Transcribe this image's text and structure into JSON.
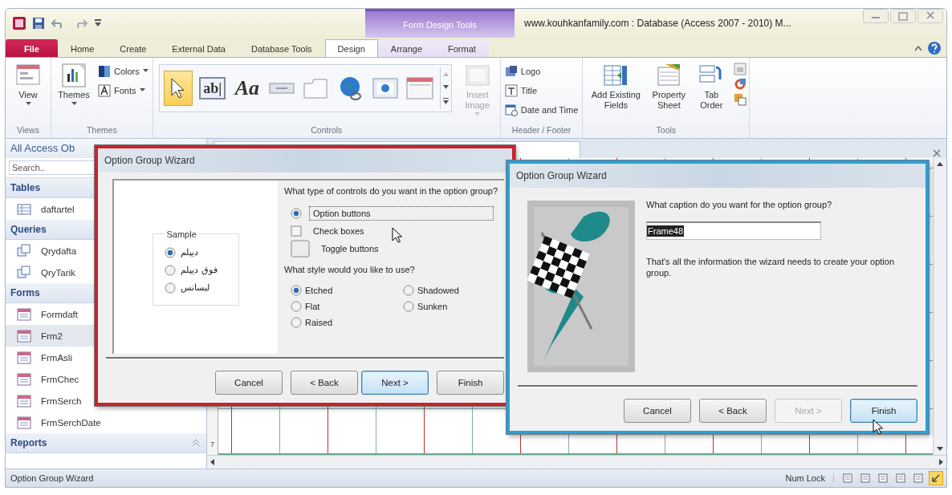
{
  "window": {
    "contextual_tab": "Form Design Tools",
    "title": "www.kouhkanfamily.com : Database (Access 2007 - 2010) M..."
  },
  "ribbon_tabs": [
    {
      "label": "File",
      "kind": "file",
      "selected": false
    },
    {
      "label": "Home",
      "kind": "tab",
      "selected": false
    },
    {
      "label": "Create",
      "kind": "tab",
      "selected": false
    },
    {
      "label": "External Data",
      "kind": "tab",
      "selected": false
    },
    {
      "label": "Database Tools",
      "kind": "tab",
      "selected": false
    },
    {
      "label": "Design",
      "kind": "contextual",
      "selected": true
    },
    {
      "label": "Arrange",
      "kind": "contextual",
      "selected": false
    },
    {
      "label": "Format",
      "kind": "contextual",
      "selected": false
    }
  ],
  "ribbon_groups": [
    {
      "label": "Views",
      "kind": "buttons",
      "items": [
        {
          "label": "View",
          "kind": "large",
          "dropdown": true,
          "disabled": false
        }
      ]
    },
    {
      "label": "Themes",
      "kind": "buttons",
      "items": [
        {
          "label": "Themes",
          "kind": "large",
          "dropdown": true,
          "disabled": false
        },
        {
          "label": "Colors",
          "kind": "small",
          "dropdown": true,
          "disabled": false
        },
        {
          "label": "Fonts",
          "kind": "small",
          "dropdown": true,
          "disabled": false
        }
      ]
    },
    {
      "label": "Controls",
      "kind": "gallery",
      "gallery": [
        {
          "kind": "pointer",
          "selected": true
        },
        {
          "kind": "text_box",
          "glyph": "ab|",
          "selected": false
        },
        {
          "kind": "label",
          "glyph": "Aa",
          "selected": false
        },
        {
          "kind": "button",
          "selected": false
        },
        {
          "kind": "tab_control",
          "selected": false
        },
        {
          "kind": "hyperlink",
          "selected": false
        },
        {
          "kind": "web_browser",
          "selected": false
        },
        {
          "kind": "navigation",
          "selected": false
        }
      ],
      "items": [
        {
          "label": "Insert Image",
          "kind": "large",
          "dropdown": true,
          "disabled": true
        }
      ]
    },
    {
      "label": "Header / Footer",
      "kind": "buttons",
      "items": [
        {
          "label": "Logo",
          "kind": "small",
          "dropdown": false,
          "disabled": false
        },
        {
          "label": "Title",
          "kind": "small",
          "dropdown": false,
          "disabled": false
        },
        {
          "label": "Date and Time",
          "kind": "small",
          "dropdown": false,
          "disabled": false
        }
      ]
    },
    {
      "label": "Tools",
      "kind": "buttons",
      "items": [
        {
          "label": "Add Existing Fields",
          "kind": "large",
          "dropdown": false,
          "disabled": false
        },
        {
          "label": "Property Sheet",
          "kind": "large",
          "dropdown": false,
          "disabled": false
        },
        {
          "label": "Tab Order",
          "kind": "large",
          "dropdown": false,
          "disabled": false
        },
        {
          "kind": "icon",
          "dropdown": false,
          "disabled": false
        },
        {
          "kind": "icon",
          "dropdown": false,
          "disabled": false
        },
        {
          "kind": "icon",
          "dropdown": false,
          "disabled": false
        }
      ]
    }
  ],
  "navigation_pane": {
    "title": "All Access Ob",
    "search_placeholder": "Search..",
    "sections": [
      {
        "label": "Tables",
        "kind": "table",
        "items": [
          {
            "label": "daftartel",
            "selected": false
          }
        ]
      },
      {
        "label": "Queries",
        "kind": "query",
        "items": [
          {
            "label": "Qrydafta",
            "selected": false
          },
          {
            "label": "QryTarik",
            "selected": false
          }
        ]
      },
      {
        "label": "Forms",
        "kind": "form",
        "items": [
          {
            "label": "Formdaft",
            "selected": false
          },
          {
            "label": "Frm2",
            "selected": true
          },
          {
            "label": "FrmAsli",
            "selected": false
          },
          {
            "label": "FrmChec",
            "selected": false
          },
          {
            "label": "FrmSerch",
            "selected": false
          },
          {
            "label": "FrmSerchDate",
            "selected": false
          }
        ]
      },
      {
        "label": "Reports"
      }
    ]
  },
  "design_area": {
    "ruler_label": "7"
  },
  "wizards": [
    {
      "kind": "control_type",
      "color": "#c8232b",
      "title": "Option Group Wizard",
      "sample": {
        "label": "Sample",
        "options": [
          {
            "label": "دیپلم",
            "selected": true
          },
          {
            "label": "فوق دیپلم",
            "selected": false
          },
          {
            "label": "لیسانس",
            "selected": false
          }
        ]
      },
      "question": "What type of controls do you want in the option group?",
      "control_types": [
        {
          "label": "Option buttons",
          "kind": "radio",
          "selected": true
        },
        {
          "label": "Check boxes",
          "kind": "checkbox",
          "selected": false
        },
        {
          "label": "Toggle buttons",
          "kind": "toggle",
          "selected": false
        }
      ],
      "style_question": "What style would you like to use?",
      "styles": [
        {
          "label": "Etched",
          "selected": true
        },
        {
          "label": "Shadowed",
          "selected": false
        },
        {
          "label": "Flat",
          "selected": false
        },
        {
          "label": "Sunken",
          "selected": false
        },
        {
          "label": "Raised",
          "selected": false
        }
      ],
      "buttons": [
        {
          "label": "Cancel",
          "disabled": false,
          "focused": false
        },
        {
          "label": "< Back",
          "disabled": false,
          "focused": false
        },
        {
          "label": "Next >",
          "disabled": false,
          "focused": true
        },
        {
          "label": "Finish",
          "disabled": false,
          "focused": false
        }
      ]
    },
    {
      "kind": "caption",
      "color": "#2a9fd6",
      "title": "Option Group Wizard",
      "question": "What caption do you want for the option group?",
      "caption": {
        "value": "Frame48"
      },
      "info": "That's all the information the wizard needs to create your option group.",
      "buttons": [
        {
          "label": "Cancel",
          "disabled": false,
          "focused": false
        },
        {
          "label": "< Back",
          "disabled": false,
          "focused": false
        },
        {
          "label": "Next >",
          "disabled": true,
          "focused": false
        },
        {
          "label": "Finish",
          "disabled": false,
          "focused": true
        }
      ]
    }
  ],
  "status_bar": {
    "message": "Option Group Wizard",
    "indicator": "Num Lock",
    "view_buttons": [
      {
        "selected": false
      },
      {
        "selected": false
      },
      {
        "selected": false
      },
      {
        "selected": false
      },
      {
        "selected": false
      },
      {
        "selected": true
      }
    ]
  }
}
